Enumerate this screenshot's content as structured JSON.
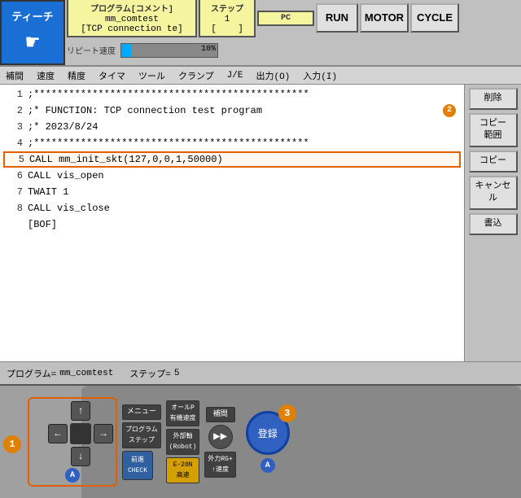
{
  "header": {
    "teach_label": "ティーチ",
    "program_label": "プログラム[コメント]",
    "step_label": "ステップ",
    "pc_label": "PC",
    "run_label": "RUN",
    "motor_label": "MOTOR",
    "cycle_label": "CYCLE",
    "program_name": "mm_comtest",
    "program_comment": "TCP connection te",
    "step_value": "1",
    "pc_value": "",
    "speed_label": "リピート速度",
    "speed_pct": "10%"
  },
  "toolbar": {
    "items": [
      "補間",
      "速度",
      "精度",
      "タイマ",
      "ツール",
      "クランプ",
      "J/E",
      "出力(O)",
      "入力(I)"
    ]
  },
  "editor": {
    "lines": [
      {
        "num": "1",
        "content": ";***********************************************"
      },
      {
        "num": "2",
        "content": ";* FUNCTION: TCP connection test program"
      },
      {
        "num": "3",
        "content": ";* 2023/8/24"
      },
      {
        "num": "4",
        "content": ";***********************************************"
      },
      {
        "num": "5",
        "content": "CALL mm_init_skt(127,0,0,1,50000)",
        "selected": true
      },
      {
        "num": "6",
        "content": "CALL vis_open"
      },
      {
        "num": "7",
        "content": "TWAIT 1"
      },
      {
        "num": "8",
        "content": "CALL vis_close"
      },
      {
        "num": "",
        "content": "[BOF]"
      }
    ],
    "badge2": "2"
  },
  "sidebar": {
    "buttons": [
      "削除",
      "コピー\n範囲",
      "コピー",
      "キャンセル",
      "書込"
    ]
  },
  "statusbar": {
    "program_label": "プログラム=",
    "program_value": "mm_comtest",
    "step_label": "ステップ=",
    "step_value": "5"
  },
  "controller": {
    "badge1": "1",
    "badge3": "3",
    "badge_a1": "A",
    "badge_a2": "A",
    "menu_label": "メニュー",
    "allspeed_label": "オールP\n有機速度",
    "hosen_label": "補間",
    "forward_label": "▶▶",
    "program_step_label": "プログラム\nステップ",
    "external_axis_label": "外部軸\n(Robot)",
    "speed_up_label": "外力RG+\n↑速度",
    "mazen_label": "前進\nCHECK",
    "e20n_label": "E-20N\n高速",
    "register_label": "登録",
    "circle_a": "A"
  }
}
